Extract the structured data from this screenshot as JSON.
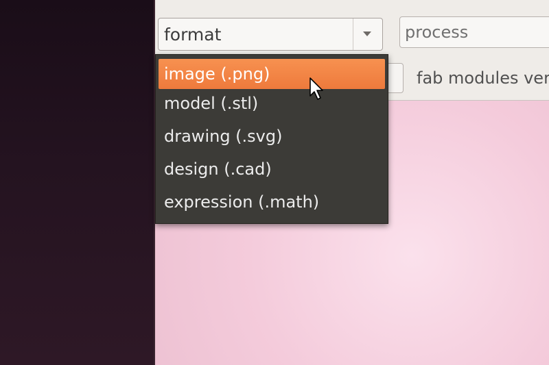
{
  "toolbar": {
    "format_combo": {
      "value": "format"
    },
    "process_field": {
      "value": "process"
    },
    "version_label": "fab modules vers"
  },
  "dropdown": {
    "selected_index": 0,
    "items": [
      {
        "label": "image (.png)"
      },
      {
        "label": "model (.stl)"
      },
      {
        "label": "drawing (.svg)"
      },
      {
        "label": "design (.cad)"
      },
      {
        "label": "expression (.math)"
      }
    ]
  },
  "colors": {
    "highlight": "#f28447",
    "menu_bg": "#3c3b37",
    "desktop_bg": "#1c0f19",
    "content_bg": "#f4cbdb"
  },
  "icons": {
    "combo_arrow": "chevron-down-icon",
    "pointer": "mouse-pointer-icon"
  }
}
